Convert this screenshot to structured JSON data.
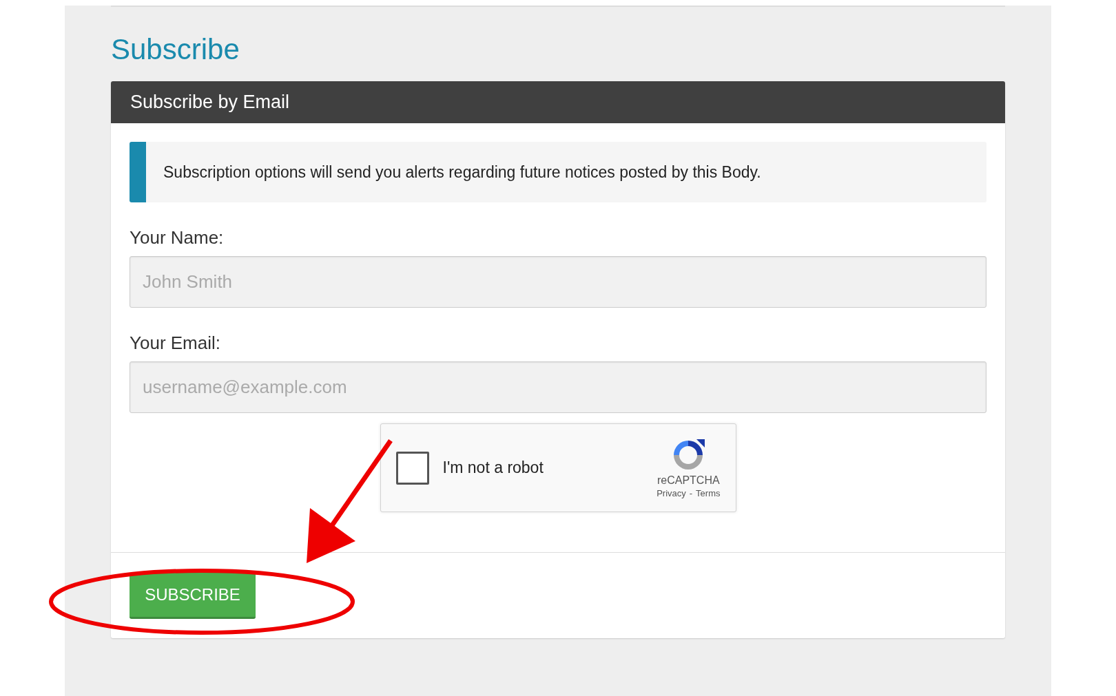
{
  "heading": "Subscribe",
  "card": {
    "title": "Subscribe by Email",
    "notice": "Subscription options will send you alerts regarding future notices posted by this Body.",
    "fields": [
      {
        "label": "Your Name:",
        "placeholder": "John Smith"
      },
      {
        "label": "Your Email:",
        "placeholder": "username@example.com"
      }
    ],
    "captcha": {
      "label": "I'm not a robot",
      "checked": false,
      "brand": "reCAPTCHA",
      "links": [
        "Privacy",
        "Terms"
      ],
      "separator": "-"
    },
    "button": "SUBSCRIBE"
  }
}
